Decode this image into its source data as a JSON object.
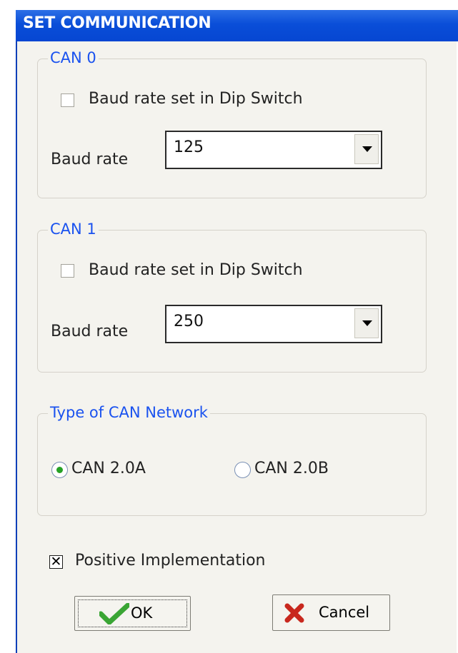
{
  "window": {
    "title": "SET COMMUNICATION",
    "accent": "#0a4ed8"
  },
  "can0": {
    "legend": "CAN 0",
    "dip_switch_label": "Baud rate set in Dip Switch",
    "dip_switch_checked": false,
    "baud_label": "Baud rate",
    "baud_value": "125"
  },
  "can1": {
    "legend": "CAN 1",
    "dip_switch_label": "Baud rate set in Dip Switch",
    "dip_switch_checked": false,
    "baud_label": "Baud rate",
    "baud_value": "250"
  },
  "network": {
    "legend": "Type of CAN Network",
    "options": [
      {
        "label": "CAN 2.0A",
        "selected": true
      },
      {
        "label": "CAN 2.0B",
        "selected": false
      }
    ]
  },
  "positive_impl": {
    "label": "Positive Implementation",
    "checked": true
  },
  "buttons": {
    "ok": {
      "label": "OK",
      "icon": "checkmark-icon",
      "color": "#3aa534"
    },
    "cancel": {
      "label": "Cancel",
      "icon": "x-mark-icon",
      "color": "#c8281e"
    }
  }
}
